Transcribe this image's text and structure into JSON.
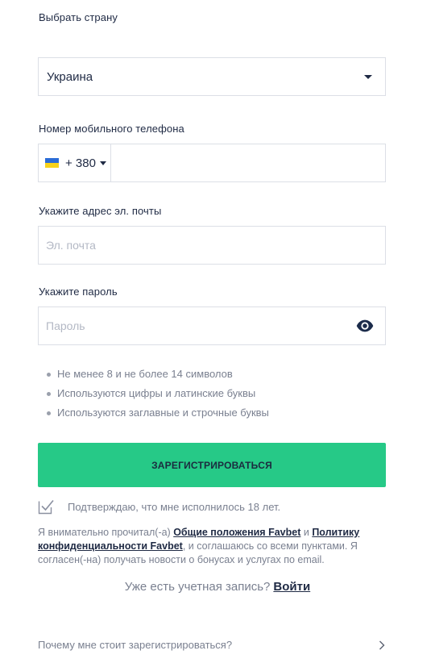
{
  "country": {
    "label": "Выбрать страну",
    "selected": "Украина"
  },
  "phone": {
    "label": "Номер мобильного телефона",
    "code": "+ 380",
    "value": "",
    "flag_colors": [
      "#2b6cd6",
      "#f7d21b"
    ]
  },
  "email": {
    "label": "Укажите адрес эл. почты",
    "placeholder": "Эл. почта"
  },
  "password": {
    "label": "Укажите пароль",
    "placeholder": "Пароль",
    "toggle_icon": "eye-icon"
  },
  "password_rules": [
    "Не менее 8 и не более 14 символов",
    "Используются цифры и латинские буквы",
    "Используются заглавные и строчные буквы"
  ],
  "submit": {
    "label": "ЗАРЕГИСТРИРОВАТЬСЯ",
    "color": "#26c987"
  },
  "age_confirm": {
    "text": "Подтверждаю, что мне исполнилось 18 лет.",
    "checked": true
  },
  "terms": {
    "part1": "Я внимательно прочитал(-а) ",
    "link1": "Общие положения Favbet",
    "part2": " и ",
    "link2": "Политику конфиденциальности Favbet",
    "part3": ", и соглашаюсь со всеми пунктами. Я согласен(-на) получать новости о бонусах и услугах по email."
  },
  "login": {
    "prompt": "Уже есть учетная запись?",
    "link": "Войти"
  },
  "why_register": {
    "text": "Почему мне стоит зарегистрироваться?"
  }
}
